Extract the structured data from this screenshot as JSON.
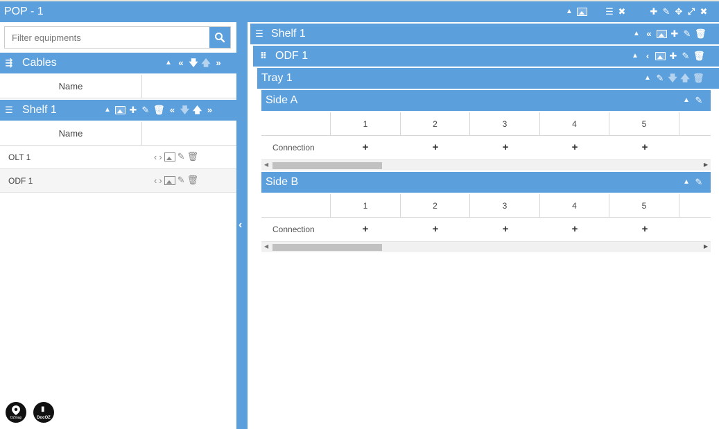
{
  "window": {
    "title": "POP - 1",
    "icons": [
      "collapse-up-icon",
      "image-icon",
      "list-icon",
      "close-icon",
      "plus-icon",
      "pencil-icon",
      "move-icon",
      "resize-icon",
      "close-icon"
    ]
  },
  "left": {
    "filter": {
      "placeholder": "Filter equipments",
      "value": ""
    },
    "cables": {
      "title": "Cables",
      "column": "Name"
    },
    "shelf": {
      "title": "Shelf 1",
      "column": "Name",
      "rows": [
        {
          "name": "OLT 1"
        },
        {
          "name": "ODF 1"
        }
      ]
    },
    "logos": [
      {
        "label": "OZmap"
      },
      {
        "label": "DocOZ"
      }
    ]
  },
  "right": {
    "shelf_title": "Shelf 1",
    "odf_title": "ODF 1",
    "tray_title": "Tray 1",
    "side_a": {
      "title": "Side A",
      "columns": [
        "1",
        "2",
        "3",
        "4",
        "5"
      ],
      "row_label": "Connection",
      "cell_symbol": "+"
    },
    "side_b": {
      "title": "Side B",
      "columns": [
        "1",
        "2",
        "3",
        "4",
        "5"
      ],
      "row_label": "Connection",
      "cell_symbol": "+"
    }
  },
  "colors": {
    "header_blue": "#5b9fdd",
    "text": "#333333"
  }
}
